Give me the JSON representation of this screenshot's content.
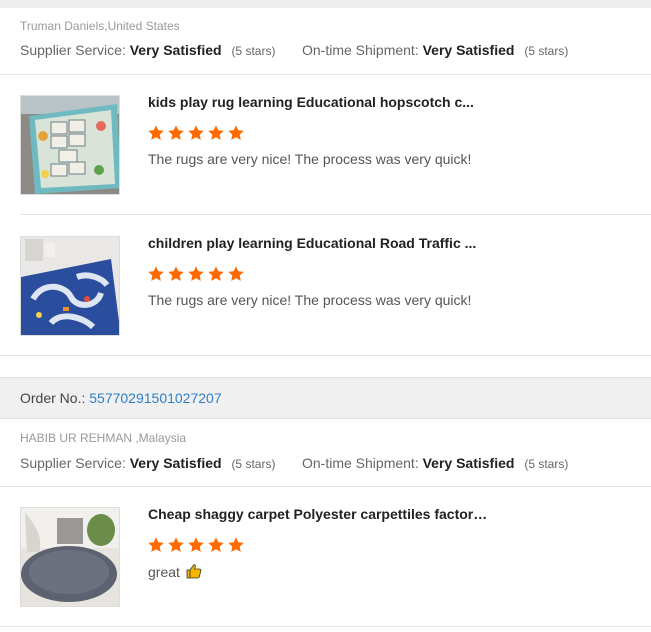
{
  "reviews": [
    {
      "buyer": "Truman Daniels,United States",
      "supplier_service_label": "Supplier Service:",
      "supplier_service_value": "Very Satisfied",
      "supplier_service_stars": "(5 stars)",
      "shipment_label": "On-time Shipment:",
      "shipment_value": "Very Satisfied",
      "shipment_stars": "(5 stars)",
      "products": [
        {
          "title": "kids play rug learning Educational hopscotch c...",
          "rating": 5,
          "comment": "The rugs are very nice! The process was very quick!",
          "thumb_icon": "hopscotch-rug-photo"
        },
        {
          "title": "children play learning Educational Road Traffic ...",
          "rating": 5,
          "comment": "The rugs are very nice! The process was very quick!",
          "thumb_icon": "road-traffic-rug-photo"
        }
      ]
    },
    {
      "order_label": "Order No.:",
      "order_number": "55770291501027207",
      "buyer": "HABIB UR REHMAN ,Malaysia",
      "supplier_service_label": "Supplier Service:",
      "supplier_service_value": "Very Satisfied",
      "supplier_service_stars": "(5 stars)",
      "shipment_label": "On-time Shipment:",
      "shipment_value": "Very Satisfied",
      "shipment_stars": "(5 stars)",
      "products": [
        {
          "title": "Cheap shaggy carpet Polyester carpettiles factory chi...",
          "rating": 5,
          "comment": "great",
          "comment_icon": "thumbs-up-icon",
          "thumb_icon": "shaggy-carpet-photo"
        }
      ]
    }
  ],
  "colors": {
    "star": "#ff6a00",
    "link": "#2e7fc9",
    "band": "#f0f0f0"
  }
}
